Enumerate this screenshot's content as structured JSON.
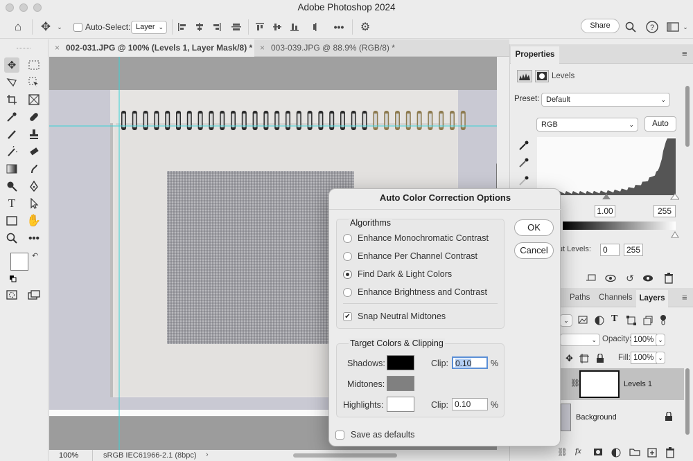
{
  "app": {
    "title": "Adobe Photoshop 2024"
  },
  "options_bar": {
    "auto_select_label": "Auto-Select:",
    "layer_select": "Layer",
    "more_label": "•••",
    "share_label": "Share"
  },
  "tabs": [
    {
      "label": "002-031.JPG @ 100% (Levels 1, Layer Mask/8) *",
      "active": true
    },
    {
      "label": "003-039.JPG @ 88.9% (RGB/8) *",
      "active": false
    }
  ],
  "status": {
    "zoom": "100%",
    "profile": "sRGB IEC61966-2.1 (8bpc)"
  },
  "properties": {
    "tab_label": "Properties",
    "adjustment_name": "Levels",
    "preset_label": "Preset:",
    "preset_value": "Default",
    "channel_value": "RGB",
    "auto_label": "Auto",
    "midtone_value": "1.00",
    "highlight_value": "255",
    "output_label": "Output Levels:",
    "output_low": "0",
    "output_high": "255"
  },
  "layers_panel": {
    "tabs": [
      "Paths",
      "Channels",
      "Layers"
    ],
    "opacity_label": "Opacity:",
    "opacity_value": "100%",
    "fill_label": "Fill:",
    "fill_value": "100%",
    "layers": [
      {
        "name": "Levels 1",
        "selected": true
      },
      {
        "name": "Background",
        "selected": false
      }
    ]
  },
  "dialog": {
    "title": "Auto Color Correction Options",
    "algorithms_title": "Algorithms",
    "options": [
      {
        "label": "Enhance Monochromatic Contrast",
        "selected": false
      },
      {
        "label": "Enhance Per Channel Contrast",
        "selected": false
      },
      {
        "label": "Find Dark & Light Colors",
        "selected": true
      },
      {
        "label": "Enhance Brightness and Contrast",
        "selected": false
      }
    ],
    "snap_label": "Snap Neutral Midtones",
    "snap_checked": true,
    "target_title": "Target Colors & Clipping",
    "shadows_label": "Shadows:",
    "midtones_label": "Midtones:",
    "highlights_label": "Highlights:",
    "clip_label": "Clip:",
    "shadows_clip": "0.10",
    "highlights_clip": "0.10",
    "percent": "%",
    "shadows_color": "#000000",
    "midtones_color": "#808080",
    "highlights_color": "#ffffff",
    "save_defaults_label": "Save as defaults",
    "ok_label": "OK",
    "cancel_label": "Cancel"
  }
}
